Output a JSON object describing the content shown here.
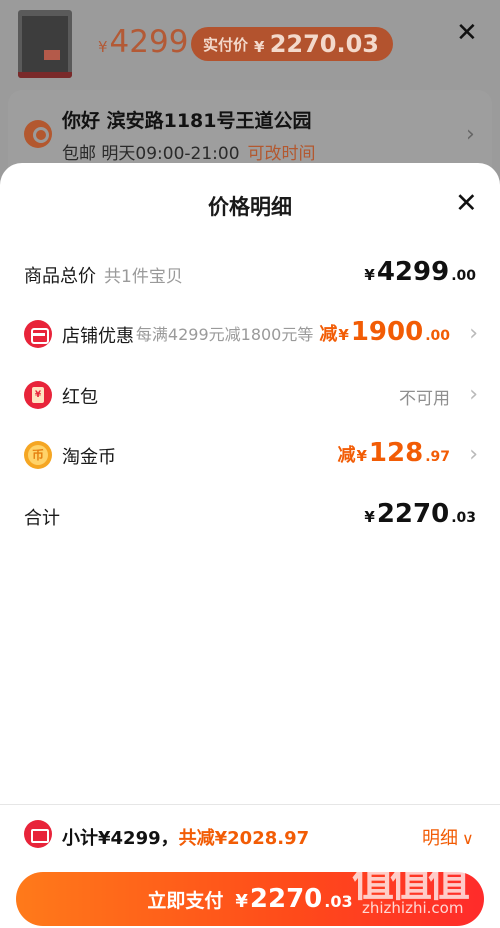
{
  "header": {
    "price_yen": "¥",
    "price": "4299",
    "paid_label": "实付价",
    "paid_yen": "¥",
    "paid_amount": "2270.03"
  },
  "address": {
    "greeting_line": "你好 滨安路1181号王道公园",
    "shipping": "包邮 明天09:00-21:00",
    "change_time": "可改时间"
  },
  "sheet": {
    "title": "价格明细",
    "rows": {
      "total": {
        "label": "商品总价",
        "sub": "共1件宝贝",
        "yen": "¥",
        "int": "4299",
        "dec": ".00"
      },
      "shop": {
        "label": "店铺优惠",
        "desc": "每满4299元减1800元等",
        "prefix": "减",
        "yen": "¥",
        "int": "1900",
        "dec": ".00"
      },
      "redpack": {
        "label": "红包",
        "status": "不可用"
      },
      "coins": {
        "label": "淘金币",
        "prefix": "减",
        "yen": "¥",
        "int": "128",
        "dec": ".97"
      },
      "sum": {
        "label": "合计",
        "yen": "¥",
        "int": "2270",
        "dec": ".03"
      }
    }
  },
  "footer": {
    "subtotal": "小计¥4299，",
    "reduction": "共减¥2028.97",
    "detail": "明细",
    "pay_label": "立即支付",
    "pay_yen": "¥",
    "pay_int": "2270",
    "pay_dec": ".03"
  },
  "watermark": {
    "logo": "值值值",
    "site": "zhizhizhi.com"
  },
  "colors": {
    "accent": "#f25c05",
    "red": "#e8243a",
    "pay_gradient_start": "#ff7a1a",
    "pay_gradient_end": "#ff2b2b"
  },
  "icons": [
    "close-icon",
    "location-pin-icon",
    "shop-discount-icon",
    "red-envelope-icon",
    "taobao-coin-icon",
    "coupon-ticket-icon",
    "chevron-right-icon",
    "chevron-down-icon"
  ]
}
